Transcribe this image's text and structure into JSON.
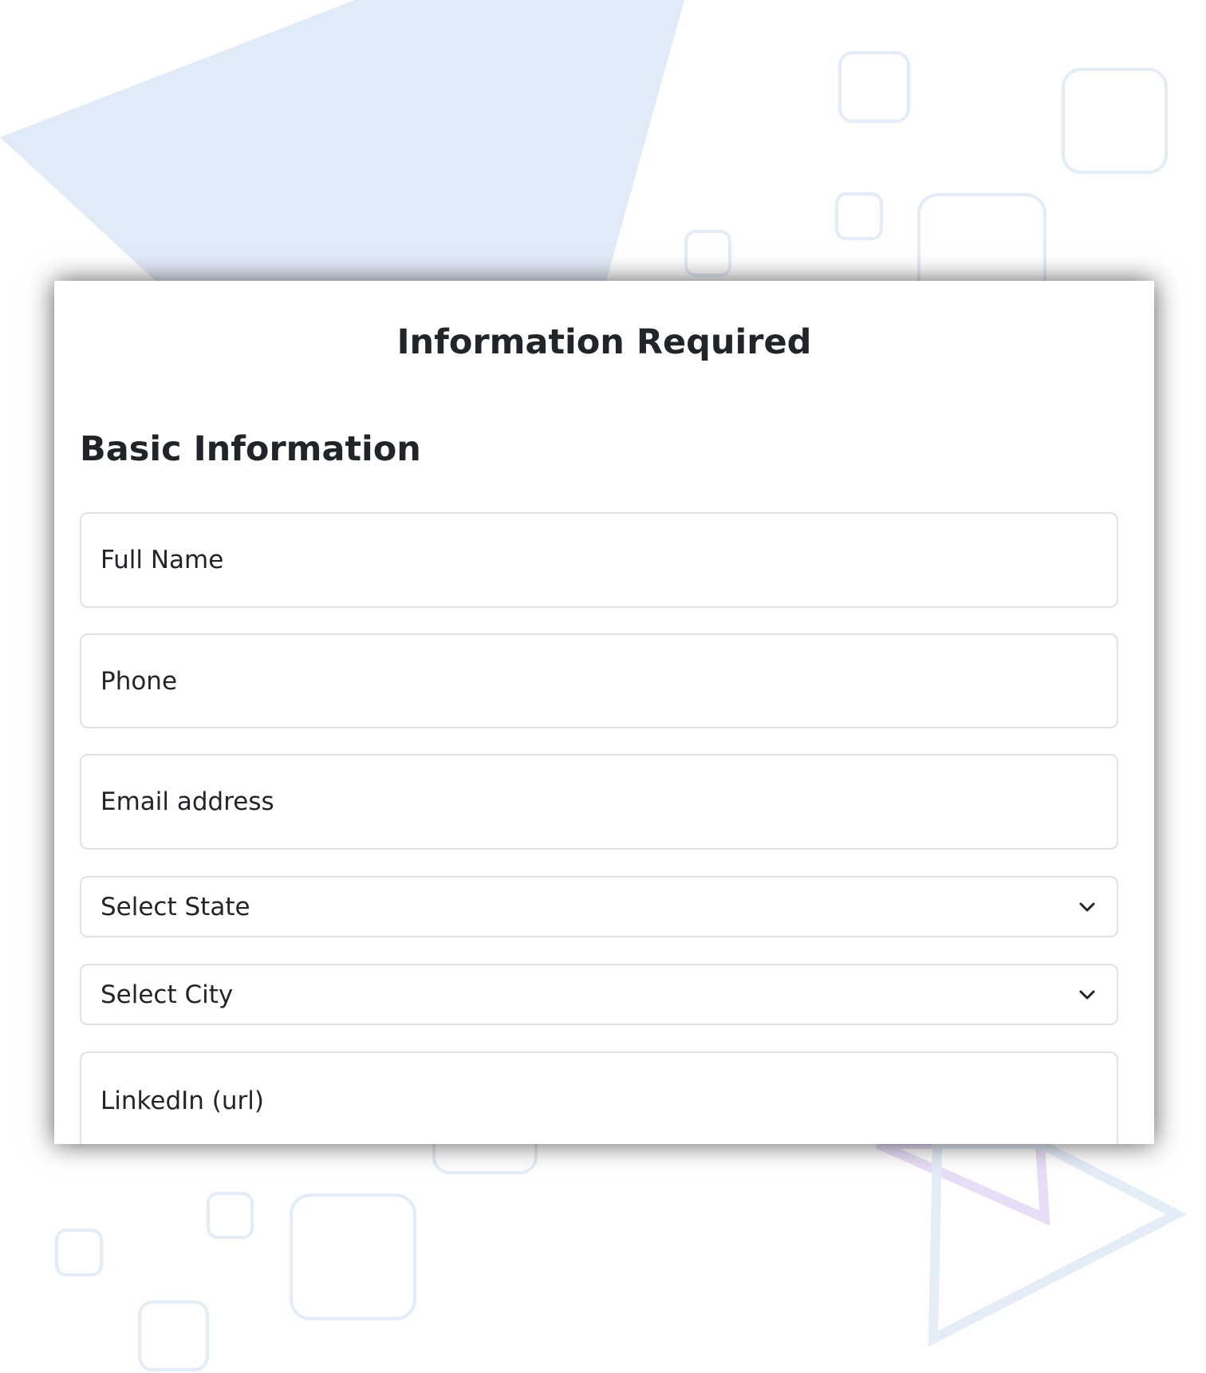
{
  "modal": {
    "title": "Information Required",
    "section_title": "Basic Information"
  },
  "form": {
    "full_name": {
      "placeholder": "Full Name"
    },
    "phone": {
      "placeholder": "Phone"
    },
    "email": {
      "placeholder": "Email address"
    },
    "state": {
      "selected": "Select State"
    },
    "city": {
      "selected": "Select City"
    },
    "linkedin": {
      "placeholder": "LinkedIn (url)"
    }
  },
  "colors": {
    "background_shape": "#e1eaf7",
    "outline_shape": "#e3ecf7",
    "purple_outline": "#e8ddf6",
    "text": "#212529",
    "field_border": "#dee2e6"
  }
}
